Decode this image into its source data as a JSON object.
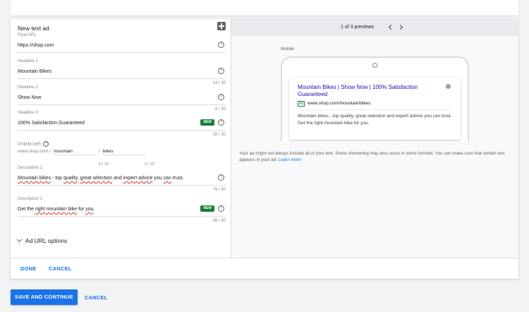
{
  "form": {
    "title": "New text ad",
    "final_url": {
      "label": "Final URL",
      "value": "https://shop.com"
    },
    "headline1": {
      "label": "Headline 1",
      "value": "Mountain Bikes",
      "count": "14 / 30"
    },
    "headline2": {
      "label": "Headline 2",
      "value": "Show Now",
      "count": "8 / 30"
    },
    "headline3": {
      "label": "Headline 3",
      "value": "100% Satisfaction Guaranteed",
      "badge": "NEW",
      "count": "28 / 30"
    },
    "display_path": {
      "label": "Display path",
      "base": "www.shop.com /",
      "path1": "mountain",
      "sep": "/",
      "path2": "bikes",
      "count1": "8 / 15",
      "count2": "5 / 15"
    },
    "description1": {
      "label": "Description 1",
      "parts": [
        "Mountain bikes",
        " - top ",
        "quality",
        ", ",
        "great selection",
        " and ",
        "expert advice",
        " you ",
        "can",
        " trust."
      ],
      "count": "78 / 90"
    },
    "description2": {
      "label": "Description 2",
      "parts": [
        "Get the ",
        "right mountain bike",
        " for ",
        "you",
        "."
      ],
      "badge": "NEW",
      "count": "36 / 90"
    },
    "url_options": "Ad URL options",
    "done": "DONE",
    "cancel": "CANCEL"
  },
  "preview": {
    "counter": "1 of 3 previews",
    "device_label": "Mobile",
    "ad": {
      "headline": "Mountain Bikes | Show Now | 100% Satisfaction Guaranteed",
      "badge": "Ad",
      "url": "www.shop.com/mountain/bikes",
      "description": "Mountain bikes - top quality, great selection and expert advice you can trust. Get the right mountain bike for you."
    },
    "notice": "Your ad might not always include all of your text. Some shortening may also occur in some formats. You can make sure that certain text appears in your ad.",
    "notice_link": "Learn more"
  },
  "footer": {
    "save": "SAVE AND CONTINUE",
    "cancel": "CANCEL"
  },
  "colors": {
    "accent": "#1a73e8",
    "new_badge": "#188038",
    "headline_link": "#1a0dab",
    "spelling_error": "#d93025"
  },
  "icons": {
    "help": "question-circle-icon",
    "add_note": "add-box-icon",
    "info": "info-icon",
    "prev": "chevron-left-icon",
    "next": "chevron-right-icon",
    "expand": "chevron-down-icon"
  }
}
